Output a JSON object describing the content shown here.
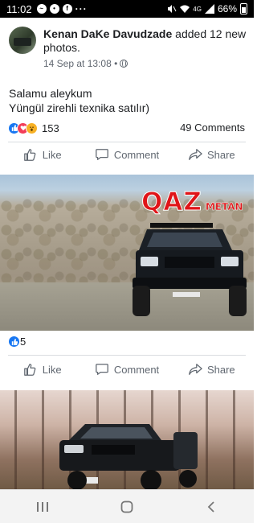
{
  "status_bar": {
    "time": "11:02",
    "icons": [
      "messenger-icon",
      "notification-icon",
      "facebook-icon"
    ],
    "more": "···",
    "network": "4G",
    "battery": "66%"
  },
  "post": {
    "author": "Kenan DaKe Davudzade",
    "action": " added 12 new photos.",
    "timestamp": "14 Sep at 13:08 •",
    "text_line1": "Salamu aleykum",
    "text_line2": "Yüngül zirehli texnika satılır)",
    "reaction_count": "153",
    "comments_count": "49 Comments"
  },
  "actions": {
    "like": "Like",
    "comment": "Comment",
    "share": "Share"
  },
  "photo1": {
    "overlay_main": "QAZ",
    "overlay_sub": "METAN",
    "reaction_count": "5"
  },
  "colors": {
    "accent": "#1877f2",
    "love": "#f33e58",
    "brand_red": "#e01418"
  }
}
